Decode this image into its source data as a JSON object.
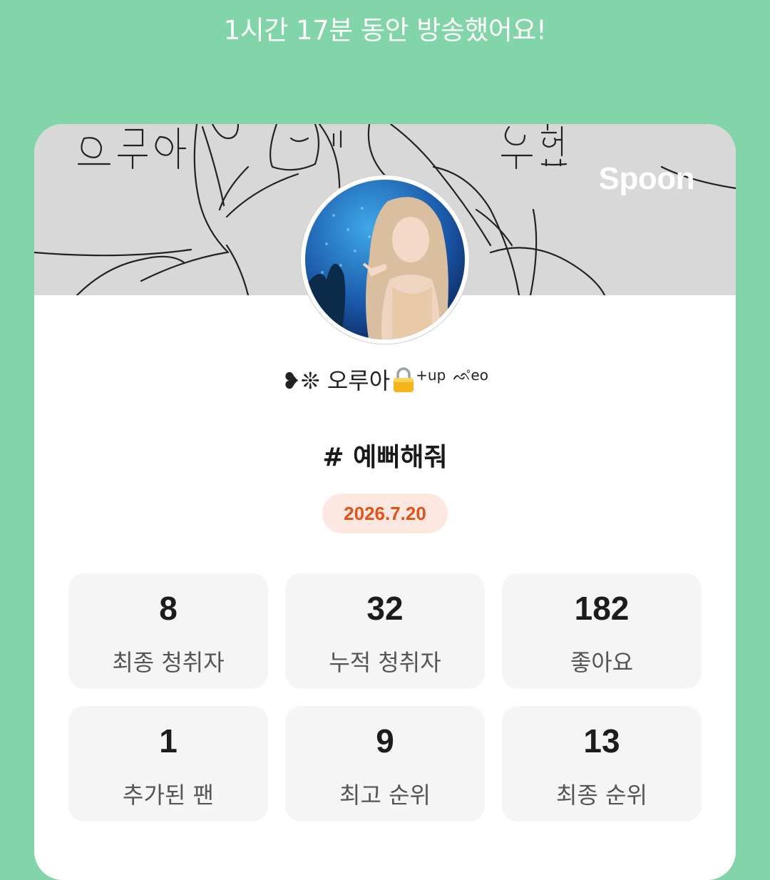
{
  "headline": "1시간 17분 동안 방송했어요!",
  "banner": {
    "brand": "Spoon"
  },
  "profile": {
    "nickname_prefix": "❥❊",
    "nickname": "오루아",
    "nickname_suffix": "+up",
    "nickname_tail": "ᨒ̊eo"
  },
  "broadcast": {
    "title": "# 예뻐해줘",
    "date": "2026.7.20"
  },
  "stats": [
    {
      "value": "8",
      "label": "최종 청취자"
    },
    {
      "value": "32",
      "label": "누적 청취자"
    },
    {
      "value": "182",
      "label": "좋아요"
    },
    {
      "value": "1",
      "label": "추가된 팬"
    },
    {
      "value": "9",
      "label": "최고 순위"
    },
    {
      "value": "13",
      "label": "최종 순위"
    }
  ],
  "colors": {
    "background": "#82D5A8",
    "accent": "#E2531C",
    "pill": "#FDE8E1",
    "card": "#FFFFFF",
    "stat_box": "#F5F5F5"
  }
}
